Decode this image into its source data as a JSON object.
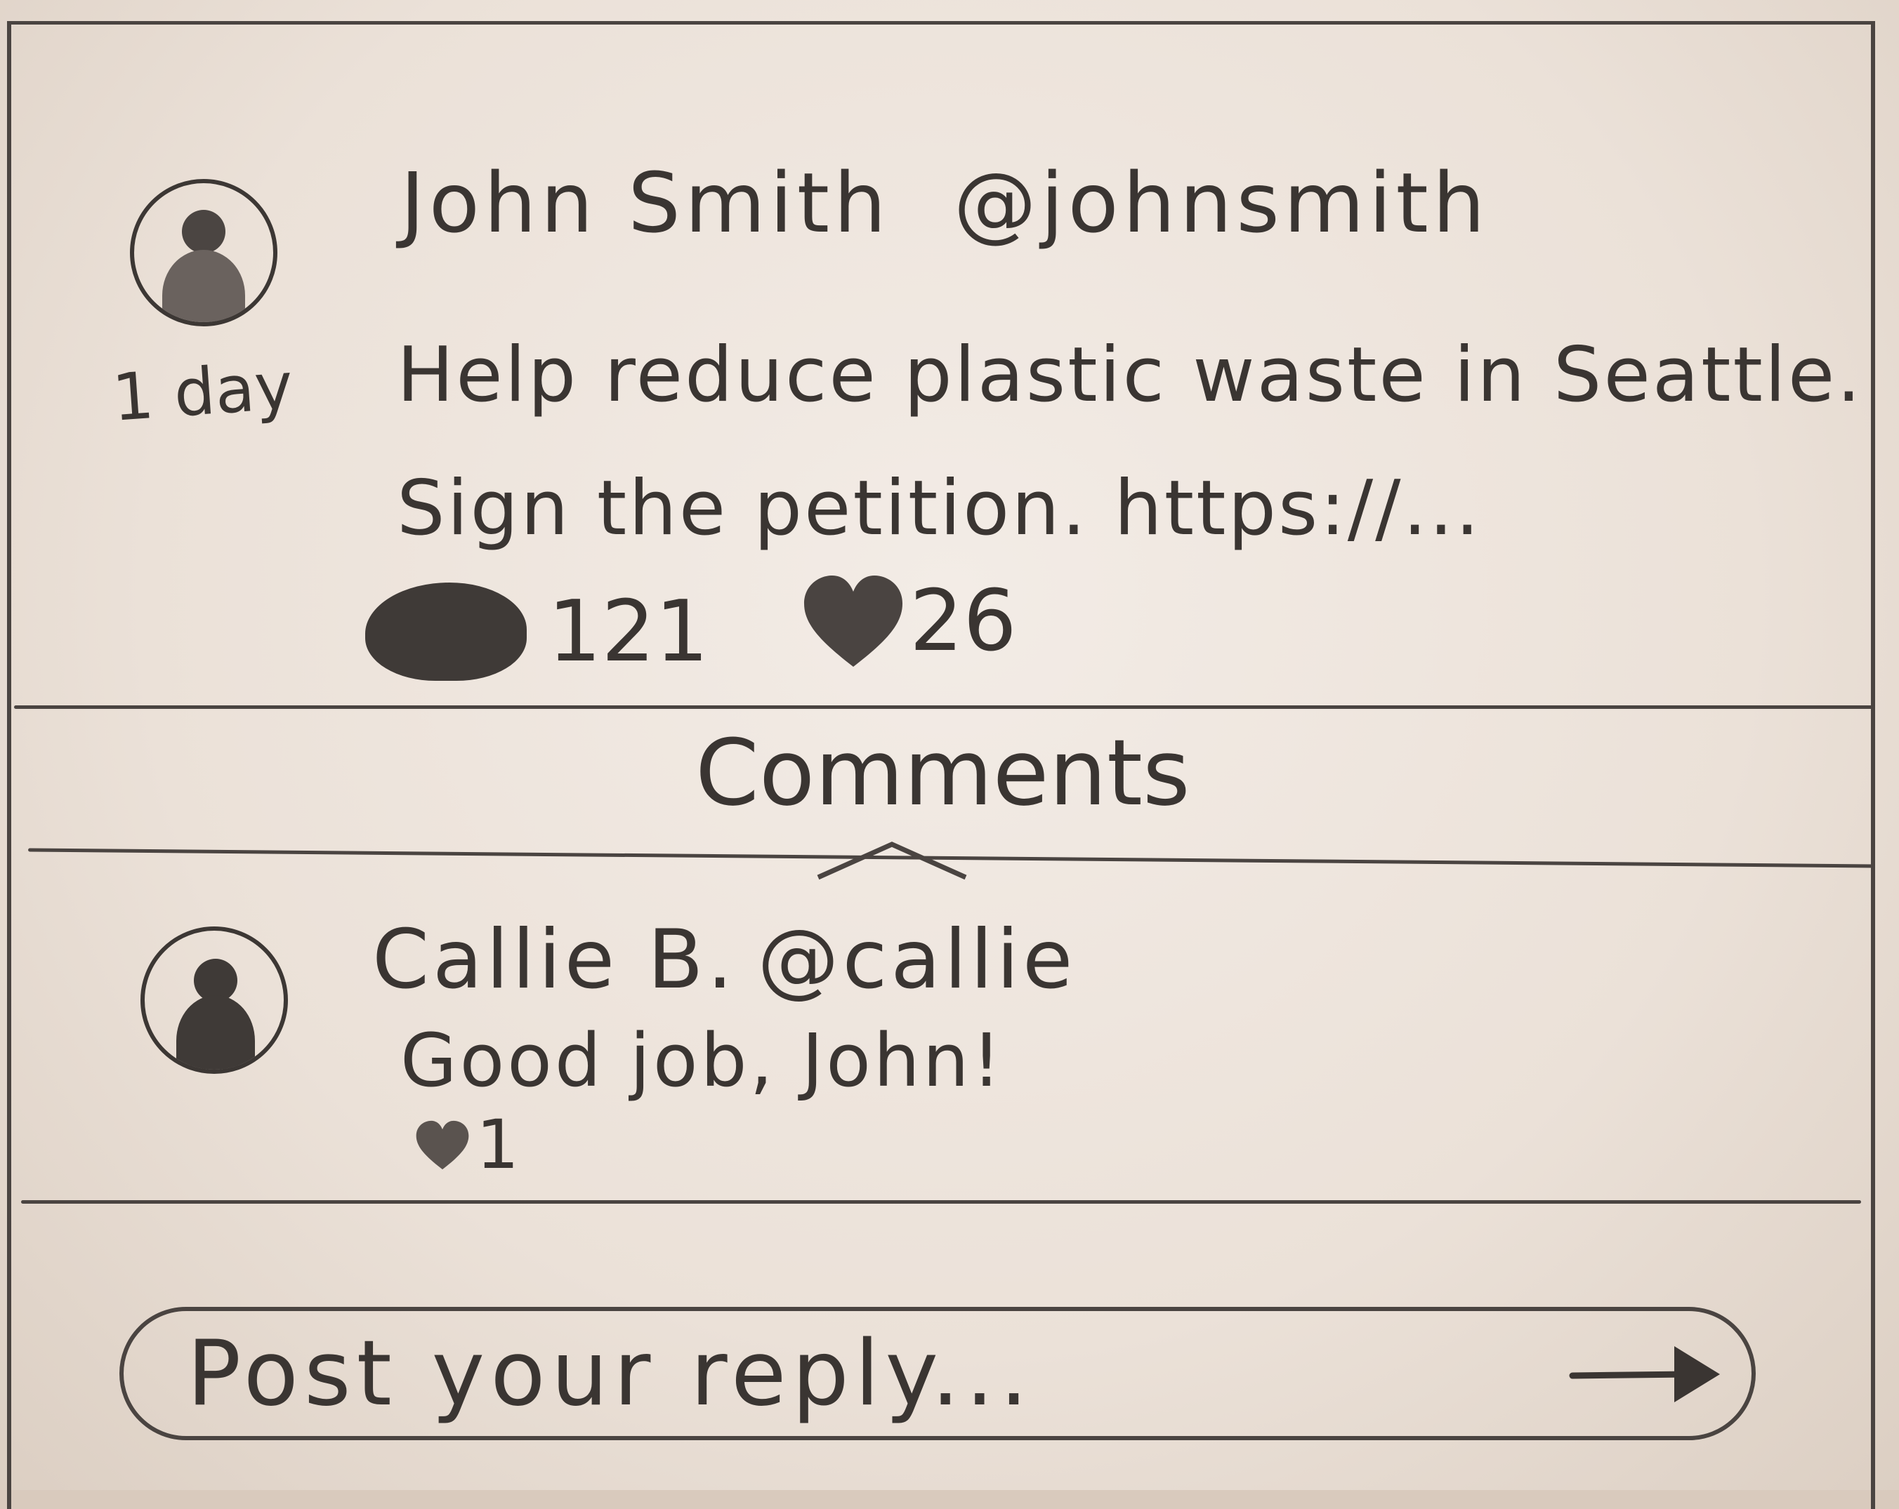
{
  "post": {
    "author_name": "John Smith",
    "author_handle": "@johnsmith",
    "time": "1 day",
    "text": "Help reduce plastic waste in Seattle. Sign the petition. https://...",
    "comment_count": "121",
    "like_count": "26"
  },
  "comments_section": {
    "label": "Comments"
  },
  "comments": [
    {
      "author_name": "Callie B.",
      "author_handle": "@callie",
      "text": "Good job, John!",
      "like_count": "1"
    }
  ],
  "reply": {
    "placeholder": "Post your reply..."
  },
  "icons": {
    "avatar": "person-icon",
    "comments": "speech-bubble-icon",
    "likes": "heart-icon",
    "collapse": "chevron-up-icon",
    "send": "arrow-right-icon"
  }
}
